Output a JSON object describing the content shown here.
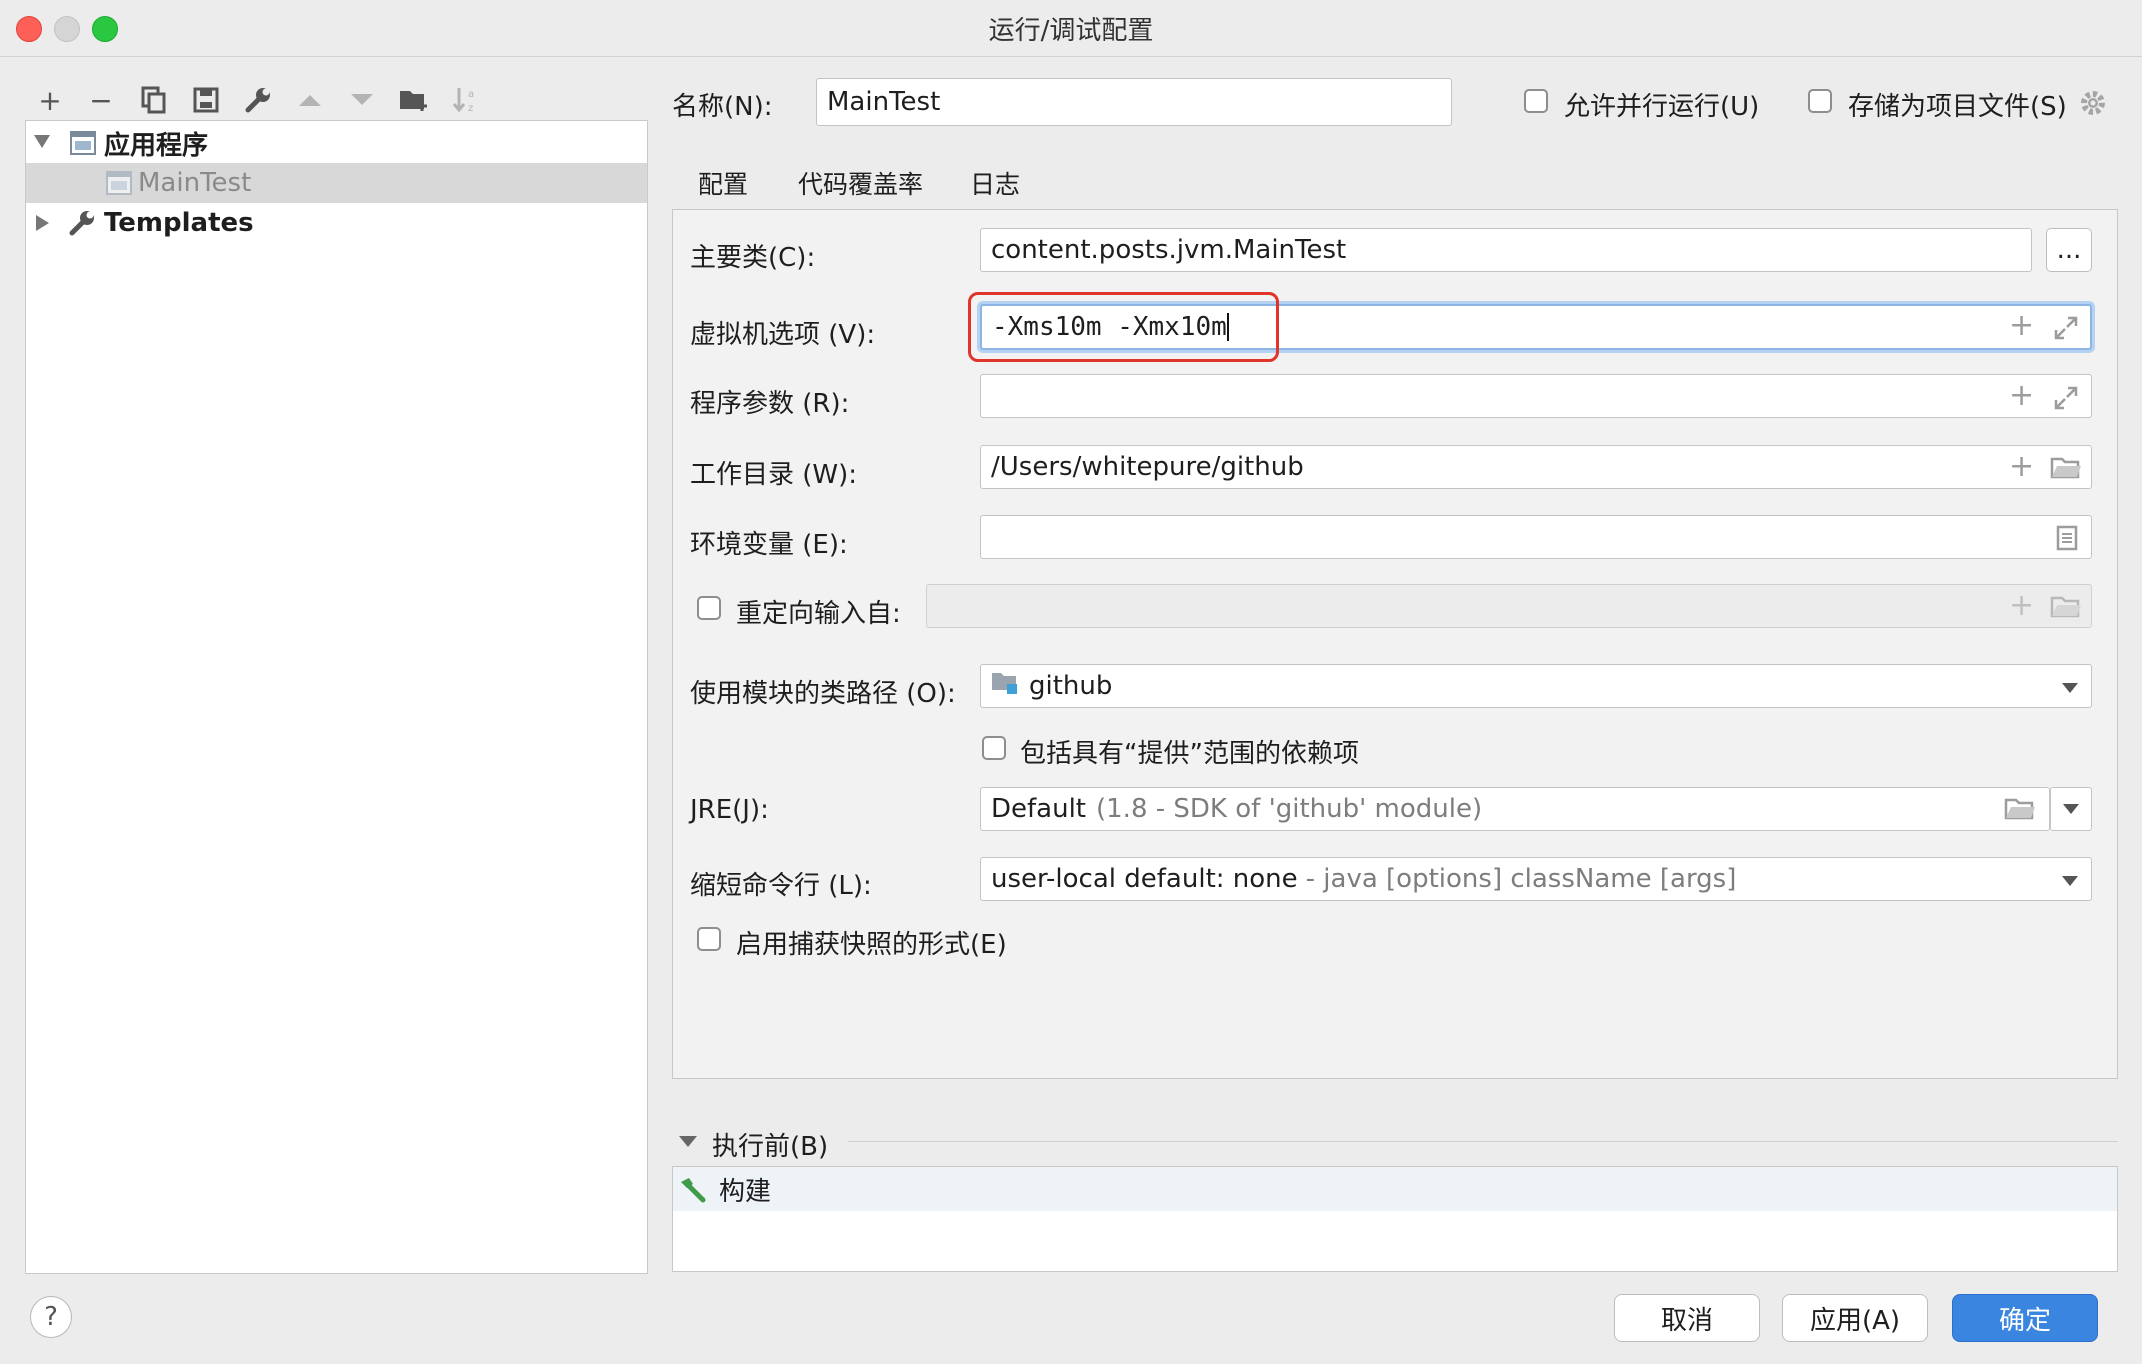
{
  "window": {
    "title": "运行/调试配置"
  },
  "tree": {
    "group_label": "应用程序",
    "config_label": "MainTest",
    "templates_label": "Templates"
  },
  "form": {
    "name_label": "名称(N):",
    "name_value": "MainTest",
    "allow_parallel_label": "允许并行运行(U)",
    "store_project_label": "存储为项目文件(S)",
    "tabs": [
      {
        "label": "配置"
      },
      {
        "label": "代码覆盖率"
      },
      {
        "label": "日志"
      }
    ],
    "main_class_label": "主要类(C):",
    "main_class_value": "content.posts.jvm.MainTest",
    "browse_label": "...",
    "vm_options_label": "虚拟机选项 (V):",
    "vm_options_value": "-Xms10m -Xmx10m",
    "program_args_label": "程序参数 (R):",
    "program_args_value": "",
    "workdir_label": "工作目录 (W):",
    "workdir_value": "/Users/whitepure/github",
    "env_label": "环境变量 (E):",
    "env_value": "",
    "redirect_label": "重定向输入自:",
    "module_label": "使用模块的类路径 (O):",
    "module_value": "github",
    "include_provided_label": "包括具有“提供”范围的依赖项",
    "jre_label": "JRE(J):",
    "jre_value": "Default",
    "jre_detail": "(1.8 - SDK of 'github' module)",
    "shorten_label": "缩短命令行 (L):",
    "shorten_value": "user-local default: none",
    "shorten_detail": "- java [options] className [args]",
    "snapshot_label": "启用捕获快照的形式(E)"
  },
  "before_launch": {
    "header": "执行前(B)",
    "items": [
      {
        "label": "构建"
      }
    ]
  },
  "buttons": {
    "help": "?",
    "cancel": "取消",
    "apply": "应用(A)",
    "ok": "确定"
  },
  "colors": {
    "accent": "#3a85e0",
    "highlight_box": "#e0352b",
    "selection": "#d8d8d8"
  }
}
